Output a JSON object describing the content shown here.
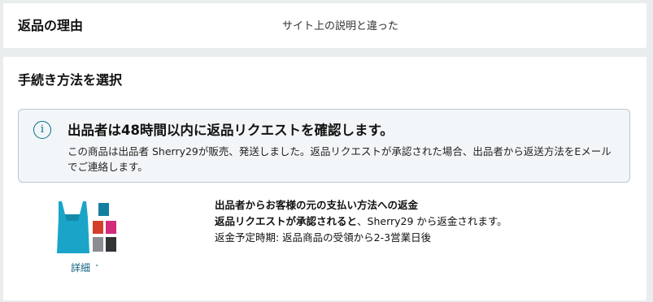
{
  "reason": {
    "title": "返品の理由",
    "value": "サイト上の説明と違った"
  },
  "method": {
    "title": "手続き方法を選択",
    "info": {
      "icon": "info-icon",
      "icon_glyph": "i",
      "heading": "出品者は48時間以内に返品リクエストを確認します。",
      "body": "この商品は出品者 Sherry29が販売、発送しました。返品リクエストが承認された場合、出品者から返送方法をEメールでご連絡します。"
    },
    "product": {
      "image_name": "tote-bag-product-image",
      "details_label": "詳細",
      "details_icon": "chevron-down-icon"
    },
    "refund": {
      "line1": "出品者からお客様の元の支払い方法への返金",
      "line2_bold": "返品リクエストが承認されると",
      "line2_rest": "、Sherry29 から返金されます。",
      "line3": "返金予定時期: 返品商品の受領から2-3営業日後"
    }
  },
  "colors": {
    "background": "#eaeded",
    "card": "#ffffff",
    "info_bg": "#f3f6f8",
    "info_border": "#b9c7d0",
    "accent": "#006e8a",
    "link": "#0f5f7e"
  }
}
